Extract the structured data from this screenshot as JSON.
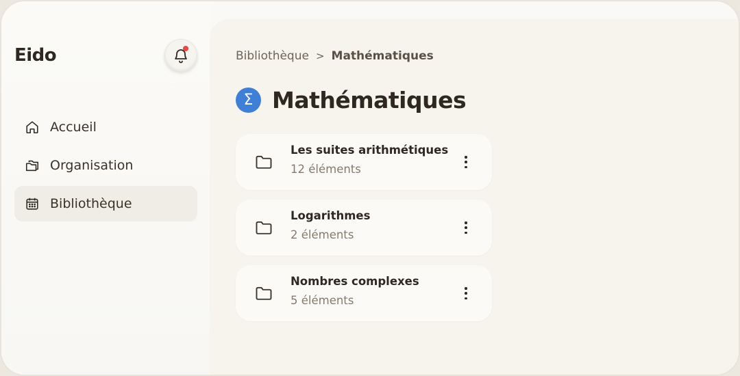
{
  "app": {
    "name": "Eido"
  },
  "notifications": {
    "has_unread": true,
    "icon": "bell-icon"
  },
  "sidebar": {
    "items": [
      {
        "label": "Accueil",
        "icon": "home-icon",
        "active": false
      },
      {
        "label": "Organisation",
        "icon": "folders-icon",
        "active": false
      },
      {
        "label": "Bibliothèque",
        "icon": "calendar-icon",
        "active": true
      }
    ]
  },
  "breadcrumb": {
    "root": "Bibliothèque",
    "separator": ">",
    "current": "Mathématiques"
  },
  "page": {
    "title": "Mathématiques",
    "icon_glyph": "Σ",
    "icon_color": "#3f7fd6"
  },
  "folders": [
    {
      "name": "Les suites arithmétiques",
      "count": "12 éléments"
    },
    {
      "name": "Logarithmes",
      "count": "2 éléments"
    },
    {
      "name": "Nombres complexes",
      "count": "5 éléments"
    }
  ],
  "colors": {
    "accent": "#3f7fd6",
    "notification_dot": "#e8474a",
    "active_nav_bg": "#efede6"
  }
}
